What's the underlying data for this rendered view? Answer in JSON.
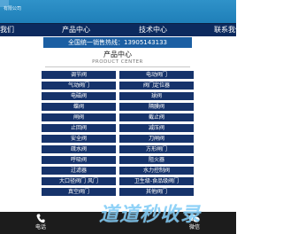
{
  "header": {
    "brand_text": "有限公司"
  },
  "nav": {
    "items": [
      "我们",
      "产品中心",
      "技术中心",
      "联系我们"
    ]
  },
  "hotline": "全国统一销售热线：13905143133",
  "products": {
    "title": "产品中心",
    "subtitle": "PRODUCT CENTER",
    "items": [
      "调节阀",
      "电动阀门",
      "气动阀门",
      "阀门定位器",
      "电磁阀",
      "球阀",
      "蝶阀",
      "隔膜阀",
      "闸阀",
      "截止阀",
      "止回阀",
      "减压阀",
      "安全阀",
      "刀闸阀",
      "疏水阀",
      "方形闸门",
      "呼吸阀",
      "阻火器",
      "过滤器",
      "水力控制阀",
      "大口径阀门 风门",
      "卫生级-食品级阀门",
      "真空阀门",
      "其他阀门"
    ]
  },
  "bottom_bar": {
    "phone_label": "电话",
    "wechat_label": "微信",
    "phone_icon": "phone-icon",
    "wechat_icon": "wechat-icon"
  },
  "watermark": "道道秒收录"
}
